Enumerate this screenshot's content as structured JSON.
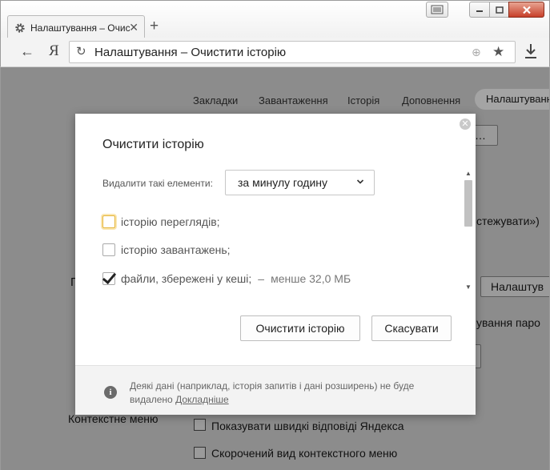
{
  "browser": {
    "tab_title": "Налаштування – Очис",
    "tab_close": "✕",
    "new_tab": "+",
    "address_text": "Налаштування – Очистити історію",
    "logo_text": "Я",
    "back_glyph": "←",
    "reload_glyph": "↻",
    "star_glyph": "★",
    "globe_glyph": "⊕"
  },
  "page": {
    "nav": [
      "Закладки",
      "Завантаження",
      "Історія",
      "Доповнення",
      "Налаштування"
    ],
    "partial_button_top": "…",
    "partial_text_tracking": "стежувати»)",
    "partial_letter": "П",
    "settings_button": "Налаштув",
    "passwords_button": "ування паро",
    "context_menu_label": "Контекстне меню",
    "show_quick_answers": "Показувати швидкі відповіді Яндекса",
    "compact_context_menu": "Скорочений вид контекстного меню"
  },
  "dialog": {
    "title": "Очистити історію",
    "close_glyph": "✕",
    "delete_label": "Видалити такі елементи:",
    "range_value": "за минулу годину",
    "options": [
      {
        "label": "історію переглядів;",
        "checked": false
      },
      {
        "label": "історію завантажень;",
        "checked": false
      },
      {
        "label": "файли, збережені у кеші;",
        "checked": true,
        "sep": "–",
        "size": "менше 32,0 МБ"
      }
    ],
    "clear_button": "Очистити історію",
    "cancel_button": "Скасувати",
    "footer_text": "Деякі дані (наприклад, історія запитів і дані розширень) не буде видалено",
    "footer_link": "Докладніше",
    "info_glyph": "i"
  },
  "colors": {
    "overlay": "#8c8c8c",
    "close_button": "#c7402a",
    "focus_ring": "#e5b437"
  }
}
